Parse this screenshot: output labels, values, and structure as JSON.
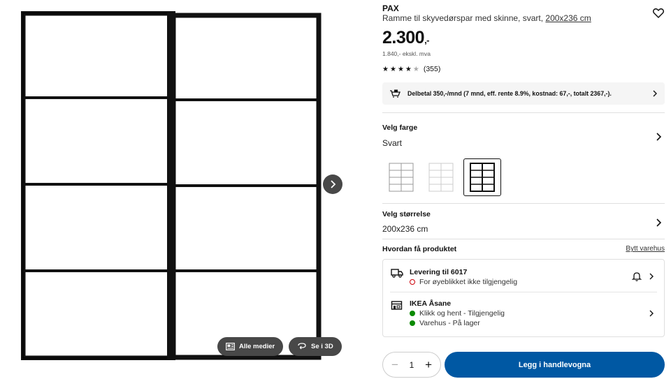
{
  "media": {
    "all_media_label": "Alle medier",
    "view_3d_label": "Se i 3D",
    "next_icon": "chevron-right-icon"
  },
  "product": {
    "brand": "PAX",
    "description": "Ramme til skyvedørspar med skinne, svart,",
    "size_link": "200x236 cm",
    "price_main": "2.300",
    "price_suffix": ",-",
    "price_ex_vat": "1.840,- ekskl. mva",
    "rating_count": "(355)",
    "rating": 4.5,
    "favorite_icon": "heart-icon"
  },
  "installment": {
    "text": "Delbetal 350,-/mnd (7 mnd, eff. rente 8.9%, kostnad: 67,-, totalt 2367,-)."
  },
  "color": {
    "label": "Velg farge",
    "value": "Svart",
    "swatches": [
      "white",
      "light",
      "black"
    ],
    "selected": "black"
  },
  "size": {
    "label": "Velg størrelse",
    "value": "200x236 cm"
  },
  "availability": {
    "heading": "Hvordan få produktet",
    "change_store": "Bytt varehus",
    "delivery": {
      "title": "Levering til 6017",
      "status": "For øyeblikket ikke tilgjengelig"
    },
    "store": {
      "title": "IKEA Åsane",
      "click_collect": "Klikk og hent - Tilgjengelig",
      "stock": "Varehus - På lager"
    }
  },
  "cart": {
    "quantity": "1",
    "add_label": "Legg i handlevogna"
  },
  "colors": {
    "accent": "#0058a3",
    "available": "#0a8a00",
    "unavailable": "#cc0008"
  }
}
